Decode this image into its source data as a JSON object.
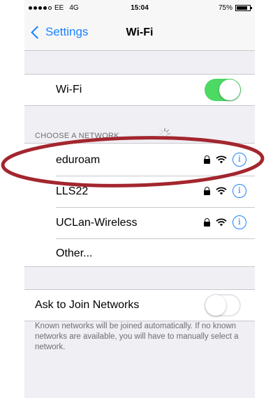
{
  "status_bar": {
    "carrier": "EE",
    "network": "4G",
    "time": "15:04",
    "battery": "75%"
  },
  "nav": {
    "back_label": "Settings",
    "title": "Wi-Fi"
  },
  "wifi_toggle": {
    "label": "Wi-Fi",
    "on": true
  },
  "networks_header": "CHOOSE A NETWORK...",
  "networks": [
    {
      "name": "eduroam"
    },
    {
      "name": "LLS22"
    },
    {
      "name": "UCLan-Wireless"
    }
  ],
  "other_label": "Other...",
  "ask_join": {
    "label": "Ask to Join Networks",
    "on": false
  },
  "footer_text": "Known networks will be joined automatically. If no known networks are available, you will have to manually select a network.",
  "colors": {
    "accent": "#1a82fb",
    "toggle_on": "#4cd964",
    "annotation": "#a3262e"
  }
}
